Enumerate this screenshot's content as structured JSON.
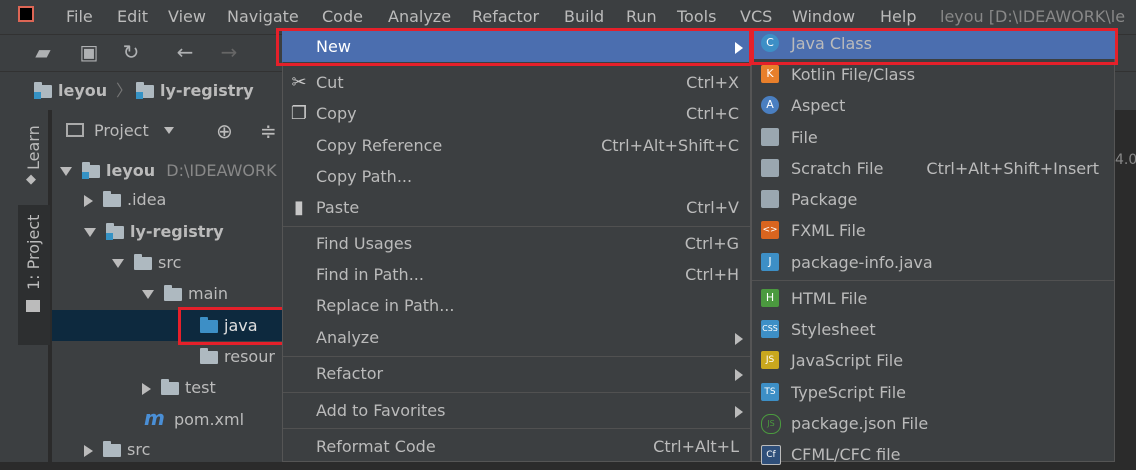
{
  "menubar": {
    "items": [
      "File",
      "Edit",
      "View",
      "Navigate",
      "Code",
      "Analyze",
      "Refactor",
      "Build",
      "Run",
      "Tools",
      "VCS",
      "Window",
      "Help"
    ],
    "title": "leyou [D:\\IDEAWORK\\le"
  },
  "navbar": {
    "crumbs": [
      "leyou",
      "ly-registry"
    ]
  },
  "left_strip": {
    "learn": "Learn",
    "project_tab": "1: Project"
  },
  "project_panel": {
    "header": "Project",
    "tree": [
      {
        "label": "leyou",
        "extra": "D:\\IDEAWORK"
      },
      {
        "label": ".idea"
      },
      {
        "label": "ly-registry"
      },
      {
        "label": "src"
      },
      {
        "label": "main"
      },
      {
        "label": "java"
      },
      {
        "label": "resour"
      },
      {
        "label": "test"
      },
      {
        "label": "pom.xml"
      },
      {
        "label": "src"
      }
    ]
  },
  "context_menu": {
    "items": [
      {
        "label": "New",
        "shortcut": ""
      },
      {
        "label": "Cut",
        "shortcut": "Ctrl+X"
      },
      {
        "label": "Copy",
        "shortcut": "Ctrl+C"
      },
      {
        "label": "Copy Reference",
        "shortcut": "Ctrl+Alt+Shift+C"
      },
      {
        "label": "Copy Path...",
        "shortcut": ""
      },
      {
        "label": "Paste",
        "shortcut": "Ctrl+V"
      },
      {
        "label": "Find Usages",
        "shortcut": "Ctrl+G"
      },
      {
        "label": "Find in Path...",
        "shortcut": "Ctrl+H"
      },
      {
        "label": "Replace in Path...",
        "shortcut": ""
      },
      {
        "label": "Analyze",
        "shortcut": ""
      },
      {
        "label": "Refactor",
        "shortcut": ""
      },
      {
        "label": "Add to Favorites",
        "shortcut": ""
      },
      {
        "label": "Reformat Code",
        "shortcut": "Ctrl+Alt+L"
      }
    ]
  },
  "new_submenu": {
    "items": [
      {
        "label": "Java Class",
        "shortcut": "",
        "icon": "C"
      },
      {
        "label": "Kotlin File/Class",
        "shortcut": "",
        "icon": "K"
      },
      {
        "label": "Aspect",
        "shortcut": "",
        "icon": "A"
      },
      {
        "label": "File",
        "shortcut": "",
        "icon": ""
      },
      {
        "label": "Scratch File",
        "shortcut": "Ctrl+Alt+Shift+Insert",
        "icon": ""
      },
      {
        "label": "Package",
        "shortcut": "",
        "icon": ""
      },
      {
        "label": "FXML File",
        "shortcut": "",
        "icon": "<>"
      },
      {
        "label": "package-info.java",
        "shortcut": "",
        "icon": "J"
      },
      {
        "label": "HTML File",
        "shortcut": "",
        "icon": "H"
      },
      {
        "label": "Stylesheet",
        "shortcut": "",
        "icon": "CSS"
      },
      {
        "label": "JavaScript File",
        "shortcut": "",
        "icon": "JS"
      },
      {
        "label": "TypeScript File",
        "shortcut": "",
        "icon": "TS"
      },
      {
        "label": "package.json File",
        "shortcut": "",
        "icon": "JS"
      },
      {
        "label": "CFML/CFC file",
        "shortcut": "",
        "icon": "Cf"
      }
    ]
  },
  "editor_edge_text": "4.0",
  "colors": {
    "highlight": "#4b6eaf",
    "annotation_red": "#e5202a",
    "selection": "#0d293e"
  }
}
